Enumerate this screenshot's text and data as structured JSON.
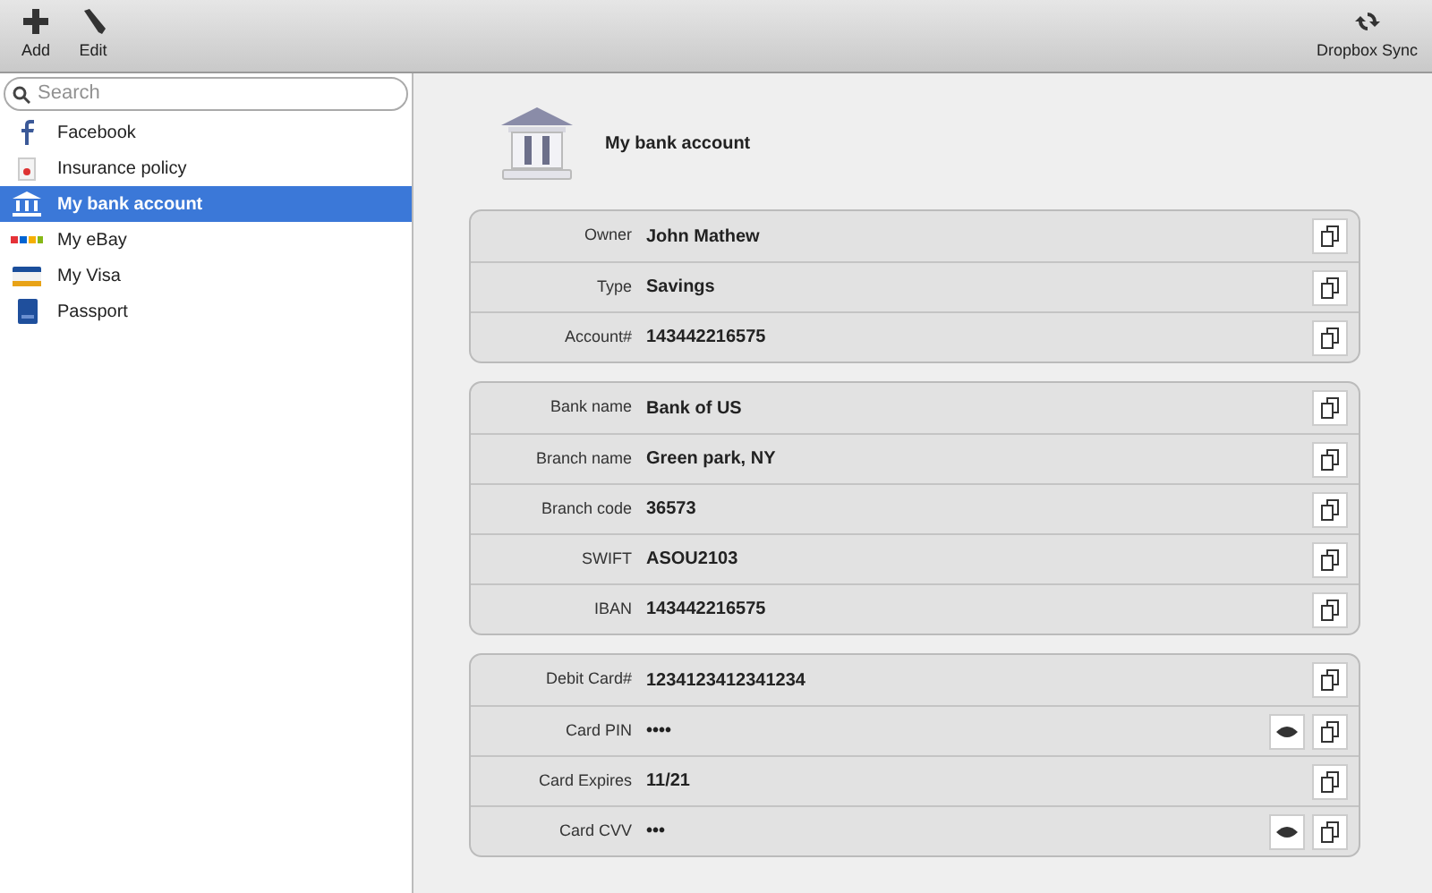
{
  "toolbar": {
    "left": [
      {
        "label": "Add",
        "kind": "plus"
      },
      {
        "label": "Edit",
        "kind": "pencil"
      }
    ],
    "right": [
      {
        "label": "Dropbox Sync",
        "kind": "sync"
      }
    ]
  },
  "sidebar": {
    "search": {
      "placeholder": "Search"
    },
    "items": [
      {
        "label": "Facebook",
        "kind": "facebook",
        "selected": false
      },
      {
        "label": "Insurance policy",
        "kind": "document",
        "selected": false
      },
      {
        "label": "My bank account",
        "kind": "bank",
        "selected": true
      },
      {
        "label": "My eBay",
        "kind": "ebay",
        "selected": false
      },
      {
        "label": "My Visa",
        "kind": "card",
        "selected": false
      },
      {
        "label": "Passport",
        "kind": "passport",
        "selected": false
      }
    ]
  },
  "detail": {
    "title": "My bank account",
    "groups": [
      [
        {
          "label": "Owner",
          "value": "John Mathew",
          "concealed": false
        },
        {
          "label": "Type",
          "value": "Savings",
          "concealed": false
        },
        {
          "label": "Account#",
          "value": "143442216575",
          "concealed": false
        }
      ],
      [
        {
          "label": "Bank name",
          "value": "Bank of US",
          "concealed": false
        },
        {
          "label": "Branch name",
          "value": "Green park, NY",
          "concealed": false
        },
        {
          "label": "Branch code",
          "value": "36573",
          "concealed": false
        },
        {
          "label": "SWIFT",
          "value": "ASOU2103",
          "concealed": false
        },
        {
          "label": "IBAN",
          "value": "143442216575",
          "concealed": false
        }
      ],
      [
        {
          "label": "Debit Card#",
          "value": "1234123412341234",
          "concealed": false
        },
        {
          "label": "Card PIN",
          "value": "••••",
          "concealed": true
        },
        {
          "label": "Card Expires",
          "value": "11/21",
          "concealed": false
        },
        {
          "label": "Card CVV",
          "value": "•••",
          "concealed": true
        }
      ]
    ]
  }
}
